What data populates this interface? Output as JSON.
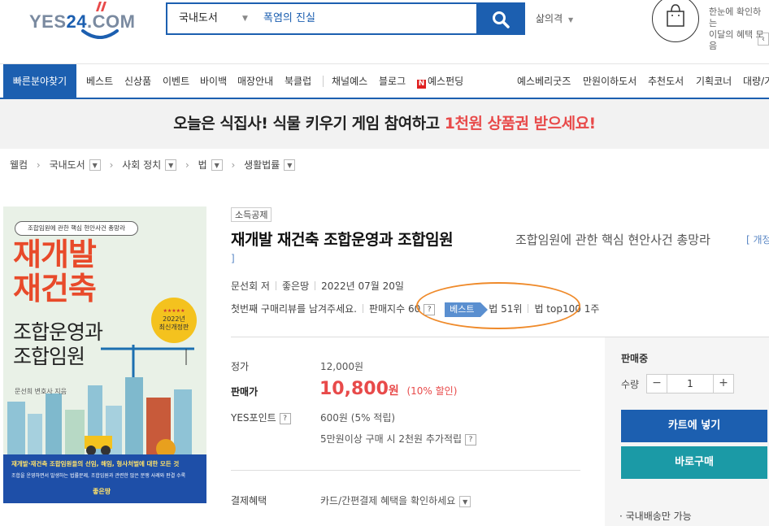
{
  "header": {
    "logo_yes": "YES",
    "logo_24": "24",
    "logo_com": ".COM",
    "search_category": "국내도서",
    "search_value": "폭염의 진실",
    "samui_label": "삶의격",
    "cart_promo_line1": "한눈에 확인하는",
    "cart_promo_line2": "이달의 혜택 모음"
  },
  "nav": {
    "quick_label": "빠른분야찾기",
    "items_left": [
      "베스트",
      "신상품",
      "이벤트",
      "바이백",
      "매장안내",
      "북클럽"
    ],
    "items_mid": [
      "채널예스",
      "블로그"
    ],
    "n_badge": "N",
    "fund_label": "예스펀딩",
    "items_right": [
      "예스베리굿즈",
      "만원이하도서",
      "추천도서",
      "기획코너",
      "대량/기"
    ]
  },
  "banner": {
    "text_before": "오늘은 식집사! 식물 키우기 게임 참여하고 ",
    "text_highlight": "1천원 상품권 받으세요!"
  },
  "breadcrumb": [
    "웰컴",
    "국내도서",
    "사회 정치",
    "법",
    "생활법률"
  ],
  "product": {
    "tag": "소득공제",
    "title": "재개발 재건축 조합운영과 조합임원",
    "subtitle": "조합임원에 관한 핵심 현안사건 총망라",
    "revise_open": "[ 개정",
    "revise_close": "]",
    "author": "문선회 저",
    "publisher": "좋은땅",
    "pub_date": "2022년 07월 20일",
    "review_prompt": "첫번째 구매리뷰를 남겨주세요.",
    "sales_index_label": "판매지수",
    "sales_index_value": "60",
    "question_mark": "?",
    "best_badge": "베스트",
    "rank_law": "법 51위",
    "rank_top100": "법 top100 1주"
  },
  "cover": {
    "top_caption": "조합임원에 관한 핵심 현안사건 총망라",
    "title_red_1": "재개발",
    "title_red_2": "재건축",
    "title_black_1": "조합운영과",
    "title_black_2": "조합임원",
    "sticker_stars": "★★★★★",
    "sticker_line1": "2022년",
    "sticker_line2": "최신개정판",
    "author_credit": "문선희 변호사 지음",
    "blue_line1": "재개발·재건축 조합임원들의 선임, 해임, 형사처벌에 대한 모든 것",
    "blue_line2": "조합을 운영하면서 발생하는 법률문제, 조합임원과 관련한 많은 분쟁 사례와 판결 수록",
    "publisher_mark": "좋은땅"
  },
  "price": {
    "list_label": "정가",
    "list_value": "12,000원",
    "sale_label": "판매가",
    "sale_value": "10,800",
    "sale_unit": "원",
    "discount": "(10% 할인)",
    "point_label": "YES포인트",
    "point_value": "600원 (5% 적립)",
    "extra_point": "5만원이상 구매 시 2천원 추가적립",
    "benefit_label": "결제혜택",
    "benefit_value": "카드/간편결제 혜택을 확인하세요"
  },
  "purchase": {
    "status": "판매중",
    "qty_label": "수량",
    "qty_minus": "−",
    "qty_value": "1",
    "qty_plus": "+",
    "cart_button": "카트에 넣기",
    "buy_button": "바로구매",
    "shipping_note": "· 국내배송만 가능"
  },
  "colors": {
    "brand_blue": "#1c5fb0",
    "sale_red": "#e84a4a",
    "teal": "#1b9aa6",
    "highlight_oval": "#ef8a2a"
  },
  "icons": {
    "search": "search-icon",
    "cart": "shopping-bag-icon",
    "dropdown": "chevron-down-icon",
    "prev": "chevron-left-icon"
  }
}
